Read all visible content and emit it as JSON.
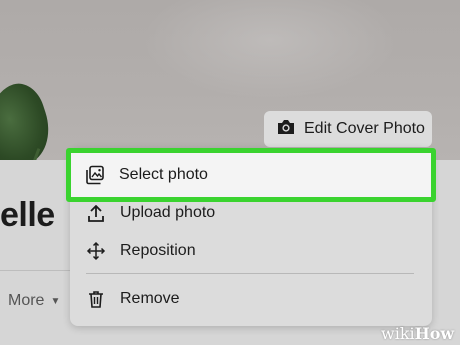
{
  "profile": {
    "name_partial": "elle",
    "more_tab_label": "More"
  },
  "cover": {
    "edit_button_label": "Edit Cover Photo"
  },
  "menu": {
    "items": [
      {
        "label": "Select photo",
        "icon": "gallery-icon",
        "highlighted": true
      },
      {
        "label": "Upload photo",
        "icon": "upload-icon"
      },
      {
        "label": "Reposition",
        "icon": "move-icon"
      },
      {
        "label": "Remove",
        "icon": "trash-icon"
      }
    ]
  },
  "colors": {
    "highlight_border": "#3ad32f"
  },
  "watermark": {
    "prefix": "wiki",
    "suffix": "How"
  }
}
